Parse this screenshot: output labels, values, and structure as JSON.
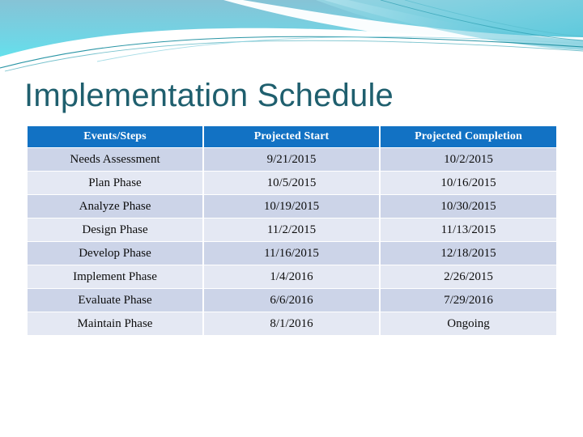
{
  "slide": {
    "title": "Implementation Schedule",
    "title_color": "#1f5f6e",
    "background_color": "#ffffff"
  },
  "banner": {
    "name": "decorative-swoosh-banner",
    "gradient_start": "#7fc4d8",
    "gradient_end": "#5fe8f0",
    "accent_teal": "#1f8fa0",
    "accent_light": "#a8e4ef"
  },
  "table": {
    "header_bg": "#1272c4",
    "header_text_color": "#ffffff",
    "row_dark_bg": "#ccd4e8",
    "row_light_bg": "#e4e8f3",
    "cell_text_color": "#0d0d0d",
    "columns": [
      "Events/Steps",
      "Projected Start",
      "Projected Completion"
    ],
    "rows": [
      [
        "Needs Assessment",
        "9/21/2015",
        "10/2/2015"
      ],
      [
        "Plan Phase",
        "10/5/2015",
        "10/16/2015"
      ],
      [
        "Analyze Phase",
        "10/19/2015",
        "10/30/2015"
      ],
      [
        "Design Phase",
        "11/2/2015",
        "11/13/2015"
      ],
      [
        "Develop Phase",
        "11/16/2015",
        "12/18/2015"
      ],
      [
        "Implement Phase",
        "1/4/2016",
        "2/26/2015"
      ],
      [
        "Evaluate Phase",
        "6/6/2016",
        "7/29/2016"
      ],
      [
        "Maintain Phase",
        "8/1/2016",
        "Ongoing"
      ]
    ]
  }
}
